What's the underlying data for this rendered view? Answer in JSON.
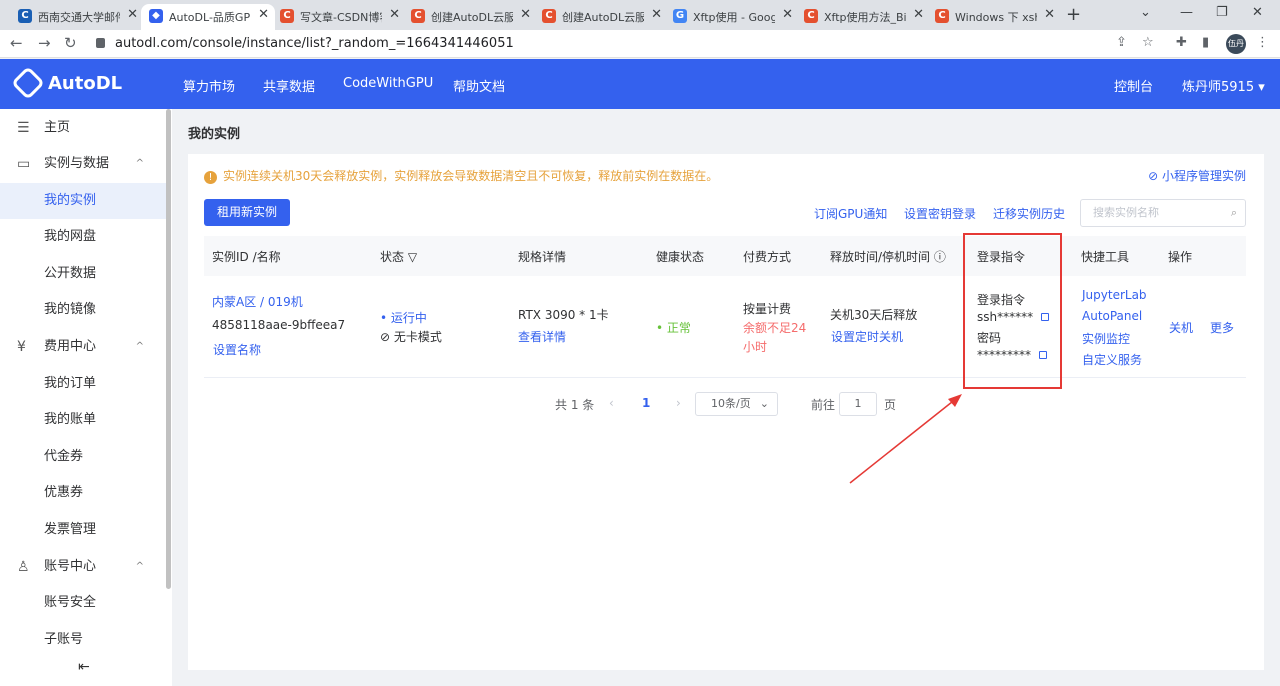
{
  "browser": {
    "tabs": [
      {
        "icon": "csdn-icon",
        "label": "西南交通大学邮件",
        "color": "#1a5fb4",
        "glyph": "C"
      },
      {
        "icon": "autodl-icon",
        "label": "AutoDL-品质GPU",
        "color": "#3461ee",
        "glyph": "◆"
      },
      {
        "icon": "csdn-icon",
        "label": "写文章-CSDN博客",
        "color": "#e4502f",
        "glyph": "C"
      },
      {
        "icon": "csdn-icon",
        "label": "创建AutoDL云服务",
        "color": "#e4502f",
        "glyph": "C"
      },
      {
        "icon": "csdn-icon",
        "label": "创建AutoDL云服务",
        "color": "#e4502f",
        "glyph": "C"
      },
      {
        "icon": "google-icon",
        "label": "Xftp使用 - Google",
        "color": "#4285f4",
        "glyph": "G"
      },
      {
        "icon": "csdn-icon",
        "label": "Xftp使用方法_Bil",
        "color": "#e4502f",
        "glyph": "C"
      },
      {
        "icon": "csdn-icon",
        "label": "Windows 下 xsh",
        "color": "#e4502f",
        "glyph": "C"
      }
    ],
    "url": "autodl.com/console/instance/list?_random_=1664341446051",
    "profile_label": "伍丹"
  },
  "header": {
    "logo": "AutoDL",
    "nav": [
      "算力市场",
      "共享数据",
      "CodeWithGPU",
      "帮助文档"
    ],
    "console": "控制台",
    "user": "炼丹师5915 ▾"
  },
  "sidebar": {
    "items": [
      {
        "label": "主页",
        "icon": "home-icon",
        "glyph": "☰",
        "arrow": ""
      },
      {
        "label": "实例与数据",
        "icon": "instance-icon",
        "glyph": "▭",
        "arrow": "^"
      },
      {
        "label": "我的实例",
        "icon": "",
        "glyph": "",
        "arrow": "",
        "active": true
      },
      {
        "label": "我的网盘",
        "icon": "",
        "glyph": "",
        "arrow": ""
      },
      {
        "label": "公开数据",
        "icon": "",
        "glyph": "",
        "arrow": ""
      },
      {
        "label": "我的镜像",
        "icon": "",
        "glyph": "",
        "arrow": ""
      },
      {
        "label": "费用中心",
        "icon": "yen-icon",
        "glyph": "¥",
        "arrow": "^"
      },
      {
        "label": "我的订单",
        "icon": "",
        "glyph": "",
        "arrow": ""
      },
      {
        "label": "我的账单",
        "icon": "",
        "glyph": "",
        "arrow": ""
      },
      {
        "label": "代金券",
        "icon": "",
        "glyph": "",
        "arrow": ""
      },
      {
        "label": "优惠券",
        "icon": "",
        "glyph": "",
        "arrow": ""
      },
      {
        "label": "发票管理",
        "icon": "",
        "glyph": "",
        "arrow": ""
      },
      {
        "label": "账号中心",
        "icon": "user-icon",
        "glyph": "♙",
        "arrow": "^"
      },
      {
        "label": "账号安全",
        "icon": "",
        "glyph": "",
        "arrow": ""
      },
      {
        "label": "子账号",
        "icon": "",
        "glyph": "",
        "arrow": ""
      }
    ]
  },
  "main": {
    "title": "我的实例",
    "notice": "实例连续关机30天会释放实例，实例释放会导致数据清空且不可恢复，释放前实例在数据在。",
    "mini_program": "小程序管理实例",
    "new_instance": "租用新实例",
    "actions": [
      "订阅GPU通知",
      "设置密钥登录",
      "迁移实例历史"
    ],
    "search_placeholder": "搜索实例名称",
    "columns": [
      "实例ID /名称",
      "状态",
      "规格详情",
      "健康状态",
      "付费方式",
      "释放时间/停机时间",
      "登录指令",
      "快捷工具",
      "操作"
    ],
    "row": {
      "region": "内蒙A区 / 019机",
      "instance_id": "4858118aae-9bffeea7",
      "set_name": "设置名称",
      "status": "运行中",
      "mode": "无卡模式",
      "spec": "RTX 3090 * 1卡",
      "spec_detail": "查看详情",
      "health": "正常",
      "billing": "按量计费",
      "billing_warn": "余额不足24",
      "billing_warn2": "小时",
      "release": "关机30天后释放",
      "release_link": "设置定时关机",
      "login_title": "登录指令",
      "login_ssh": "ssh******",
      "password_title": "密码",
      "password": "*********",
      "tools": [
        "JupyterLab",
        "AutoPanel",
        "实例监控",
        "自定义服务"
      ],
      "op_shutdown": "关机",
      "op_more": "更多"
    },
    "pager": {
      "total": "共 1 条",
      "page": "1",
      "size": "10条/页",
      "goto": "前往",
      "goto_val": "1",
      "page_unit": "页"
    }
  }
}
